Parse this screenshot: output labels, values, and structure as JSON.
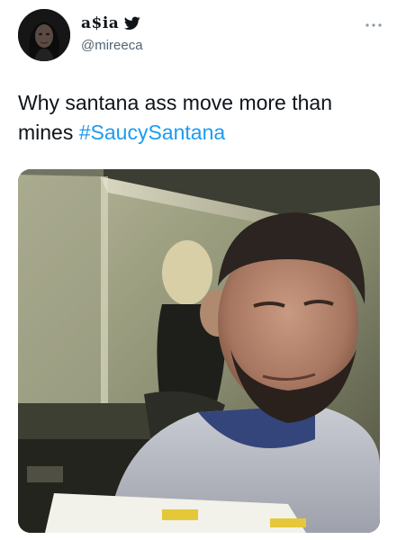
{
  "user": {
    "display_name": "a$ia",
    "handle": "@mireeca",
    "avatar_icon": "profile-photo",
    "verified_icon": "twitter-bird-icon"
  },
  "menu_icon": "more-options-icon",
  "tweet": {
    "text": "Why santana ass move more than mines",
    "hashtag": "#SaucySantana"
  },
  "media": {
    "type": "photo"
  },
  "colors": {
    "hashtag": "#1d9bf0",
    "text": "#0f1419",
    "handle": "#536471"
  }
}
